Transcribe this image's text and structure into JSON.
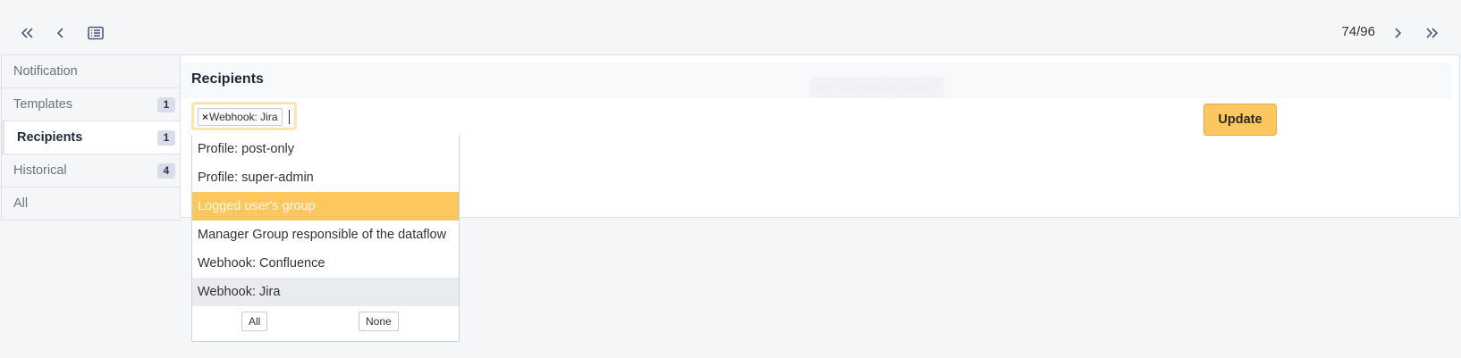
{
  "pager": {
    "counter": "74/96"
  },
  "tabs": [
    {
      "label": "Notification",
      "count": ""
    },
    {
      "label": "Templates",
      "count": "1"
    },
    {
      "label": "Recipients",
      "count": "1"
    },
    {
      "label": "Historical",
      "count": "4"
    },
    {
      "label": "All",
      "count": ""
    }
  ],
  "panel": {
    "title": "Recipients",
    "ghost_toast": "Item successfully updated",
    "update_label": "Update"
  },
  "recipients_select": {
    "selected_tag": "Webhook: Jira",
    "remove_symbol": "×",
    "options": [
      "Profile: post-only",
      "Profile: super-admin",
      "Logged user's group",
      "Manager Group responsible of the dataflow",
      "Webhook: Confluence",
      "Webhook: Jira"
    ],
    "highlighted_option": "Logged user's group",
    "selected_option": "Webhook: Jira",
    "all_label": "All",
    "none_label": "None"
  },
  "colors": {
    "accent": "#fcc75e",
    "background": "#f5f6f8",
    "panel": "#ffffff"
  },
  "icons": [
    "double-chevron-left-icon",
    "chevron-left-icon",
    "list-icon",
    "chevron-right-icon",
    "double-chevron-right-icon"
  ]
}
